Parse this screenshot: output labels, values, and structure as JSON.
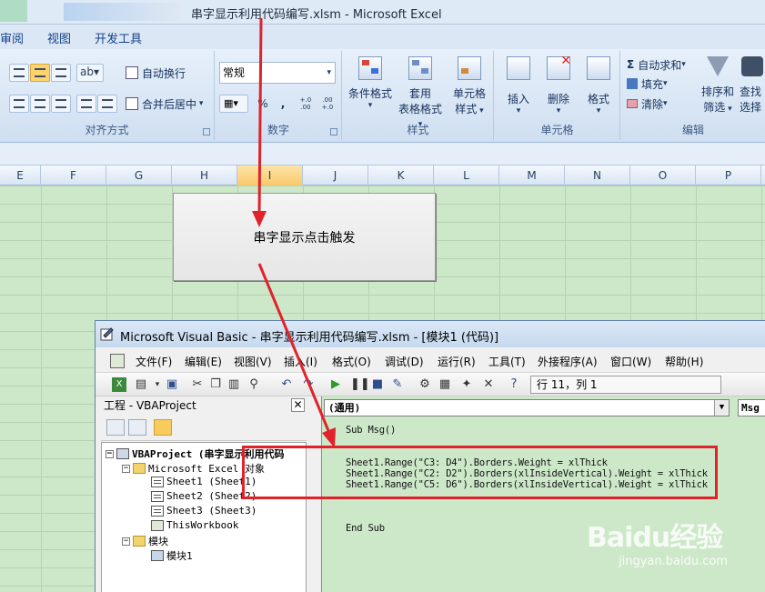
{
  "excel": {
    "title": "串字显示利用代码编写.xlsm - Microsoft Excel",
    "tabs": [
      "审阅",
      "视图",
      "开发工具"
    ],
    "ribbon": {
      "alignment": {
        "wrap_text": "自动换行",
        "merge_center": "合并后居中",
        "label": "对齐方式"
      },
      "number": {
        "format_value": "常规",
        "percent": "%",
        "comma": ",",
        "inc_decimal": "+.0 .00",
        "dec_decimal": ".00 +.0",
        "label": "数字"
      },
      "styles": {
        "conditional": "条件格式",
        "table_fmt_1": "套用",
        "table_fmt_2": "表格格式",
        "cell_style_1": "单元格",
        "cell_style_2": "样式",
        "label": "样式"
      },
      "cells": {
        "insert": "插入",
        "delete": "删除",
        "format": "格式",
        "label": "单元格"
      },
      "editing": {
        "autosum": "自动求和",
        "fill": "填充",
        "clear": "清除",
        "sort_1": "排序和",
        "sort_2": "筛选",
        "find_1": "查找",
        "find_2": "选择",
        "label": "编辑"
      }
    },
    "columns": [
      "E",
      "F",
      "G",
      "H",
      "I",
      "J",
      "K",
      "L",
      "M",
      "N",
      "O",
      "P"
    ],
    "selected_column": "I",
    "button_label": "串字显示点击触发"
  },
  "vbe": {
    "title": "Microsoft Visual Basic - 串字显示利用代码编写.xlsm - [模块1 (代码)]",
    "menu": [
      "文件(F)",
      "编辑(E)",
      "视图(V)",
      "插入(I)",
      "格式(O)",
      "调试(D)",
      "运行(R)",
      "工具(T)",
      "外接程序(A)",
      "窗口(W)",
      "帮助(H)"
    ],
    "cursor_position": "行 11，列 1",
    "project": {
      "title": "工程 - VBAProject",
      "close": "✕",
      "tree": [
        {
          "label": "VBAProject (串字显示利用代码",
          "bold": true
        },
        {
          "label": "Microsoft Excel 对象"
        },
        {
          "label": "Sheet1 (Sheet1)"
        },
        {
          "label": "Sheet2 (Sheet2)"
        },
        {
          "label": "Sheet3 (Sheet3)"
        },
        {
          "label": "ThisWorkbook"
        },
        {
          "label": "模块"
        },
        {
          "label": "模块1"
        }
      ]
    },
    "code": {
      "object_combo": "(通用)",
      "proc_combo": "Msg",
      "lines": [
        "Sub Msg()",
        "Sheet1.Range(\"C3: D4\").Borders.Weight = xlThick",
        "Sheet1.Range(\"C2: D2\").Borders(xlInsideVertical).Weight = xlThick",
        "Sheet1.Range(\"C5: D6\").Borders(xlInsideVertical).Weight = xlThick",
        "End Sub"
      ]
    }
  },
  "colors": {
    "annotation": "#e0232b",
    "grid_bg": "#cde8c9",
    "ribbon_text": "#15428b"
  },
  "watermark": {
    "logo": "Baidu经验",
    "url": "jingyan.baidu.com"
  }
}
